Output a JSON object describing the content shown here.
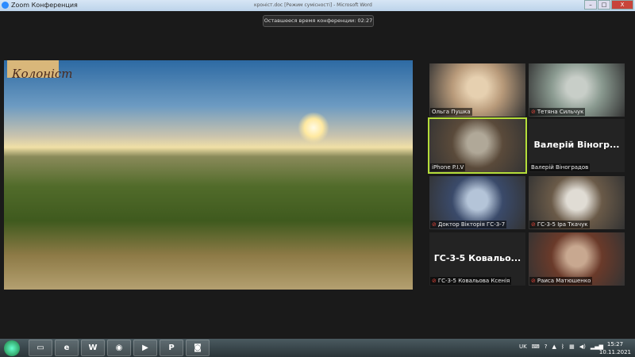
{
  "window": {
    "title": "Zoom Конференция",
    "background_title": "кроніст.doc [Режим сумісності] - Microsoft Word",
    "min": "–",
    "max": "□",
    "close": "X"
  },
  "timer": "Оставшееся время конференции: 02:27",
  "share": {
    "logo": "Колоніст"
  },
  "participants": [
    {
      "name": "Ольга Пушка",
      "muted": false,
      "video": true,
      "colors": [
        "#b89a7a",
        "#e6d0b0"
      ]
    },
    {
      "name": "Тетяна Сильчук",
      "muted": true,
      "video": true,
      "colors": [
        "#8a9a90",
        "#c8cec8"
      ]
    },
    {
      "name": "iPhone P.I.V",
      "muted": false,
      "video": true,
      "active": true,
      "colors": [
        "#5a4a3a",
        "#b0a898"
      ]
    },
    {
      "name": "Валерій Віноградов",
      "muted": false,
      "video": false,
      "big": "Валерій Віногр..."
    },
    {
      "name": "Доктор Вікторія ГС-3-7",
      "muted": true,
      "video": true,
      "colors": [
        "#3a4a6a",
        "#b4c4d8"
      ]
    },
    {
      "name": "ГС-3-5 Іра Ткачук",
      "muted": true,
      "video": true,
      "colors": [
        "#6a5a48",
        "#e0dcd4"
      ]
    },
    {
      "name": "ГС-3-5 Ковальова Ксенія",
      "muted": true,
      "video": false,
      "big": "ГС-3-5  Ковальо..."
    },
    {
      "name": "Раиса Матюшенко",
      "muted": true,
      "video": true,
      "colors": [
        "#6a3a2a",
        "#c8a890"
      ]
    }
  ],
  "taskbar": {
    "apps": [
      "explorer",
      "internet-explorer",
      "word",
      "chrome",
      "media-player",
      "powerpoint",
      "zoom"
    ],
    "app_glyphs": [
      "▭",
      "e",
      "W",
      "◉",
      "▶",
      "P",
      "◙"
    ],
    "lang": "UK",
    "time": "15:27",
    "date": "10.11.2021"
  }
}
